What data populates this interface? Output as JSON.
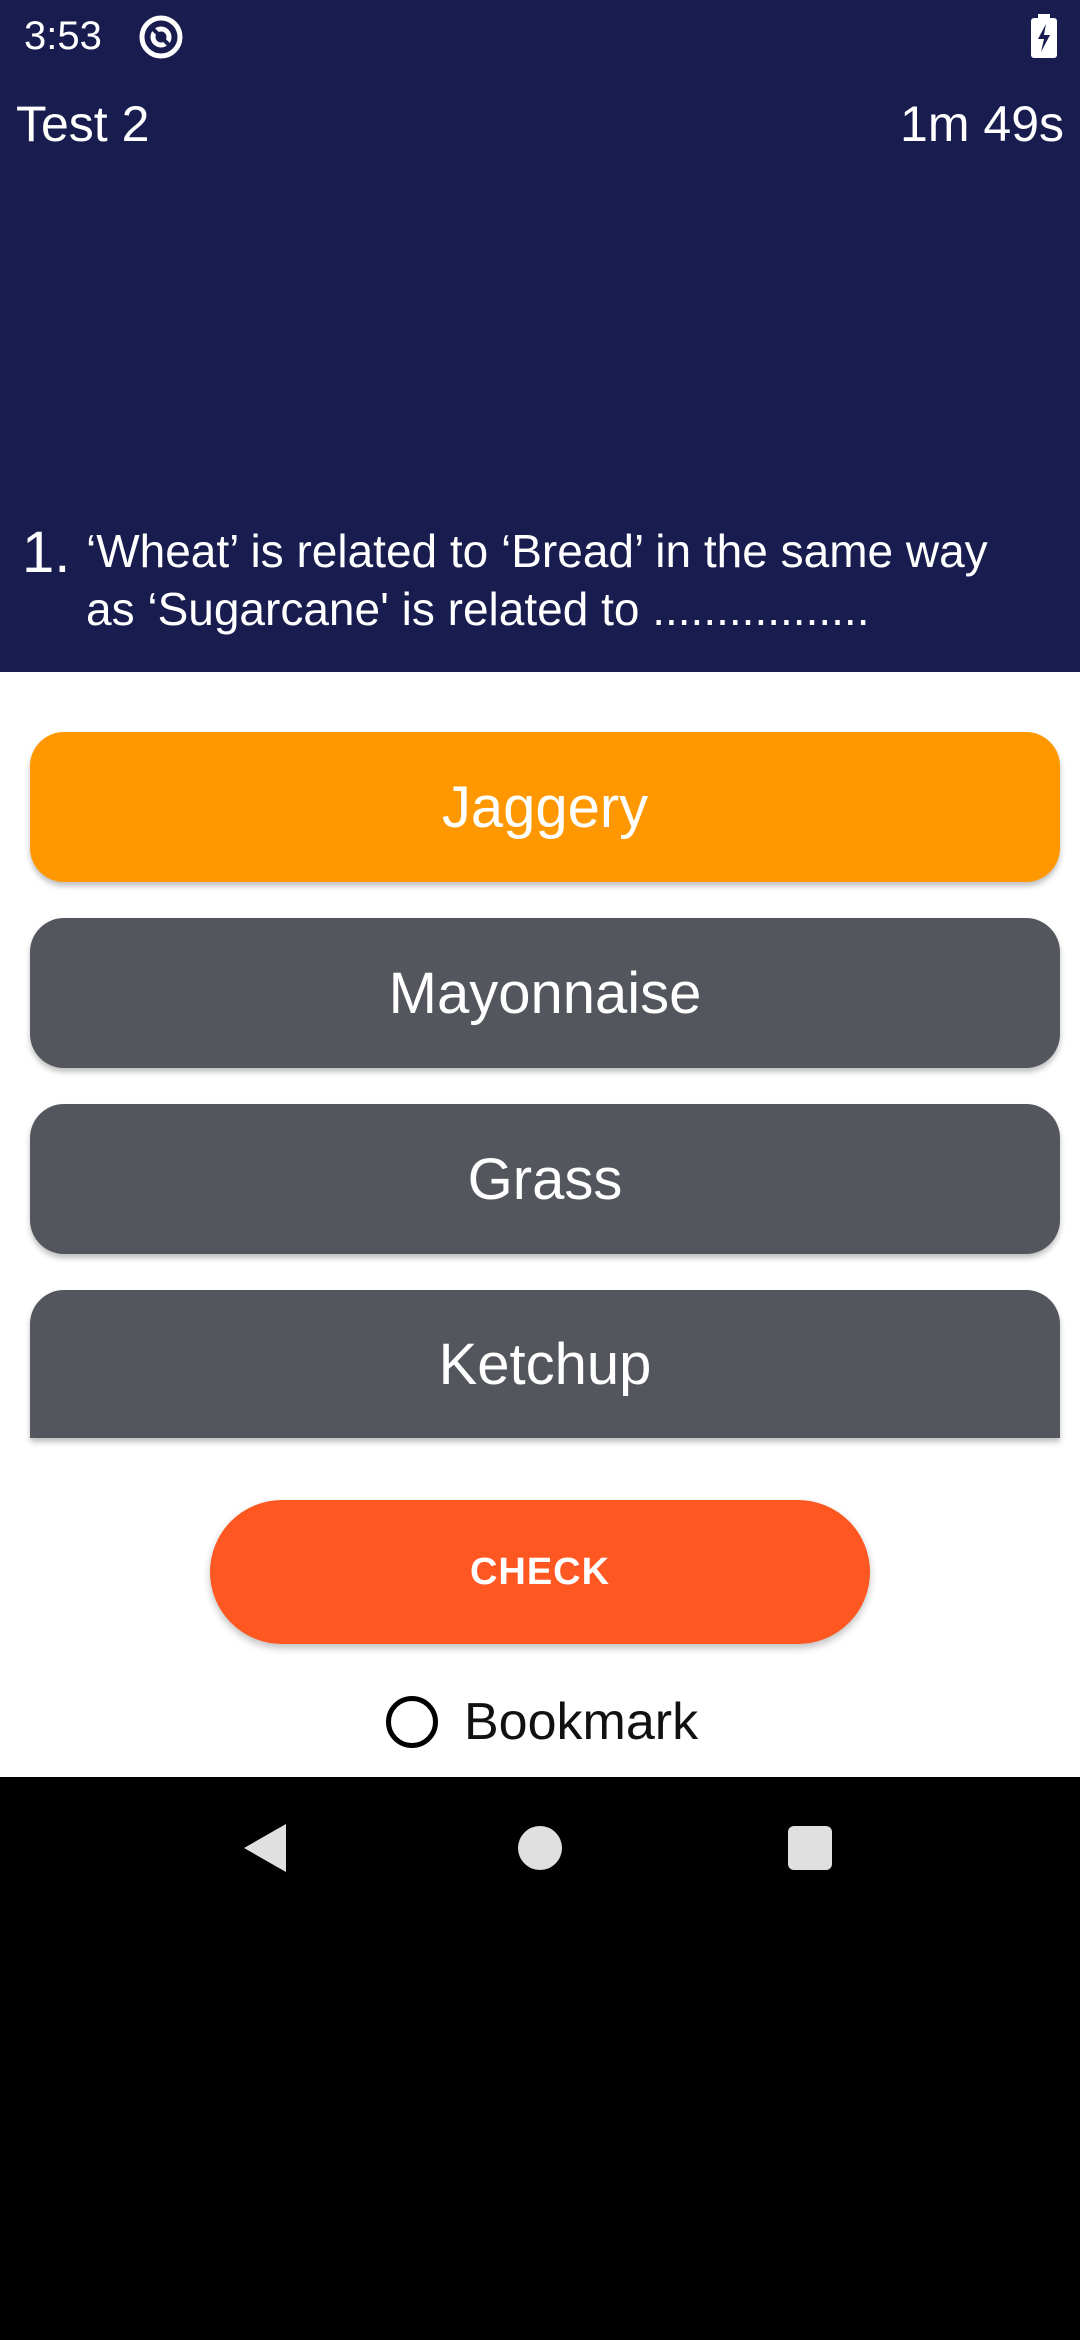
{
  "status_bar": {
    "time": "3:53",
    "app_icon": "at-sign-icon",
    "battery_icon": "battery-charging-icon"
  },
  "header": {
    "title": "Test 2",
    "timer": "1m 49s"
  },
  "question": {
    "number": "1.",
    "text": "‘Wheat’ is related to ‘Bread’ in the same way as ‘Sugarcane' is related to ................."
  },
  "options": [
    {
      "label": "Jaggery",
      "selected": true
    },
    {
      "label": "Mayonnaise",
      "selected": false
    },
    {
      "label": "Grass",
      "selected": false
    },
    {
      "label": "Ketchup",
      "selected": false
    }
  ],
  "actions": {
    "check_label": "CHECK",
    "bookmark_label": "Bookmark"
  },
  "colors": {
    "header_bg": "#181c4e",
    "selected_option": "#ff9800",
    "default_option": "#54565e",
    "check_button": "#ff5722"
  },
  "nav_bar": {
    "icons": [
      "back-icon",
      "home-icon",
      "recents-icon"
    ]
  }
}
